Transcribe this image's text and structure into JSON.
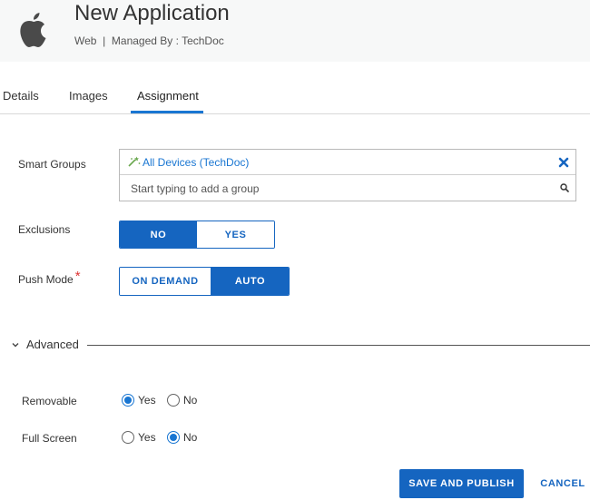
{
  "header": {
    "title": "New Application",
    "subtitle": "Web  |  Managed By : TechDoc",
    "logo_icon": "apple-logo-icon"
  },
  "tabs": [
    {
      "label": "Details",
      "active": false
    },
    {
      "label": "Images",
      "active": false
    },
    {
      "label": "Assignment",
      "active": true
    }
  ],
  "form": {
    "smart_groups": {
      "label": "Smart Groups",
      "selected_group": "All Devices (TechDoc)",
      "input_placeholder": "Start typing to add a group",
      "group_icon": "smart-group-icon",
      "remove_icon": "remove-icon",
      "search_icon": "search-icon"
    },
    "exclusions": {
      "label": "Exclusions",
      "options": [
        "NO",
        "YES"
      ],
      "selected": "NO"
    },
    "push_mode": {
      "label": "Push Mode",
      "required_mark": "*",
      "options": [
        "ON DEMAND",
        "AUTO"
      ],
      "selected": "AUTO"
    }
  },
  "advanced": {
    "label": "Advanced",
    "expanded": true,
    "removable": {
      "label": "Removable",
      "options": [
        "Yes",
        "No"
      ],
      "selected": "Yes"
    },
    "full_screen": {
      "label": "Full Screen",
      "options": [
        "Yes",
        "No"
      ],
      "selected": "No"
    }
  },
  "actions": {
    "save_label": "SAVE AND PUBLISH",
    "cancel_label": "CANCEL"
  },
  "colors": {
    "accent": "#1565c0",
    "link": "#1976d2",
    "header_bg": "#f7f8f8",
    "required": "#d33333"
  }
}
